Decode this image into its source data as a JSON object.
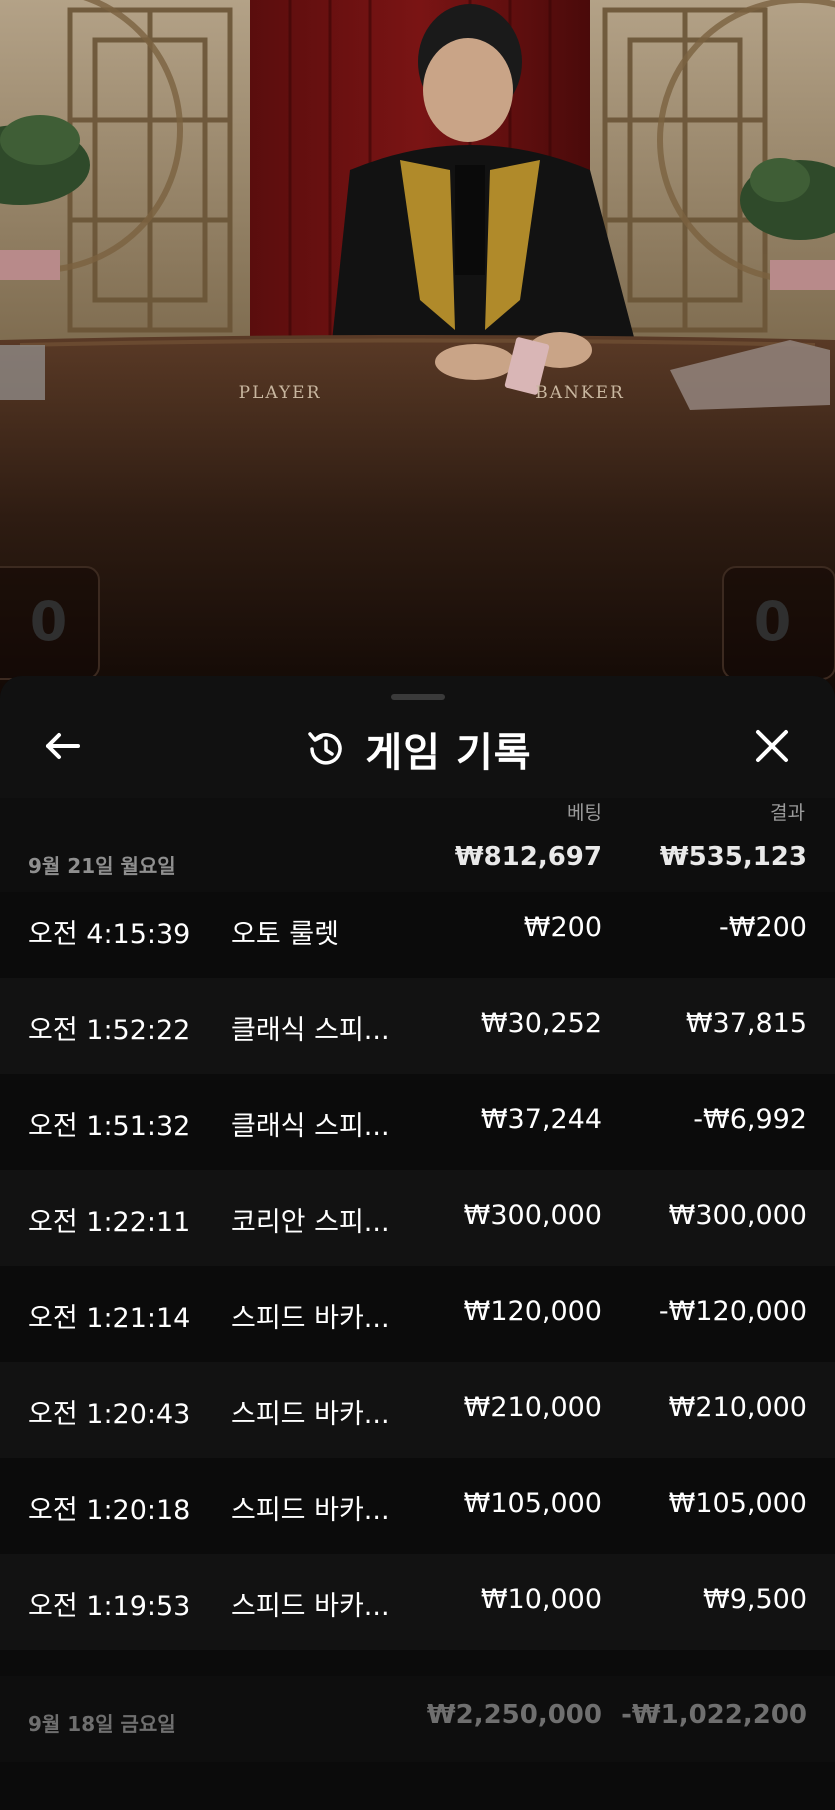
{
  "video": {
    "table_labels": [
      "PLAYER",
      "BANKER"
    ],
    "player_score": "0",
    "banker_score": "0"
  },
  "sheet": {
    "title": "게임 기록",
    "icons": {
      "back": "arrow-left-icon",
      "history": "history-clock-icon",
      "close": "close-x-icon"
    },
    "columns": {
      "bet": "베팅",
      "result": "결과"
    },
    "groups": [
      {
        "date": "9월 21일 월요일",
        "total_bet": "₩812,697",
        "total_result": "₩535,123",
        "rows": [
          {
            "time": "오전 4:15:39",
            "game": "오토 룰렛",
            "bet": "₩200",
            "result": "-₩200"
          },
          {
            "time": "오전 1:52:22",
            "game": "클래식 스피...",
            "bet": "₩30,252",
            "result": "₩37,815"
          },
          {
            "time": "오전 1:51:32",
            "game": "클래식 스피...",
            "bet": "₩37,244",
            "result": "-₩6,992"
          },
          {
            "time": "오전 1:22:11",
            "game": "코리안 스피...",
            "bet": "₩300,000",
            "result": "₩300,000"
          },
          {
            "time": "오전 1:21:14",
            "game": "스피드 바카...",
            "bet": "₩120,000",
            "result": "-₩120,000"
          },
          {
            "time": "오전 1:20:43",
            "game": "스피드 바카...",
            "bet": "₩210,000",
            "result": "₩210,000"
          },
          {
            "time": "오전 1:20:18",
            "game": "스피드 바카...",
            "bet": "₩105,000",
            "result": "₩105,000"
          },
          {
            "time": "오전 1:19:53",
            "game": "스피드 바카...",
            "bet": "₩10,000",
            "result": "₩9,500"
          }
        ]
      },
      {
        "date": "9월 18일 금요일",
        "total_bet": "₩2,250,000",
        "total_result": "-₩1,022,200",
        "rows": []
      }
    ]
  }
}
